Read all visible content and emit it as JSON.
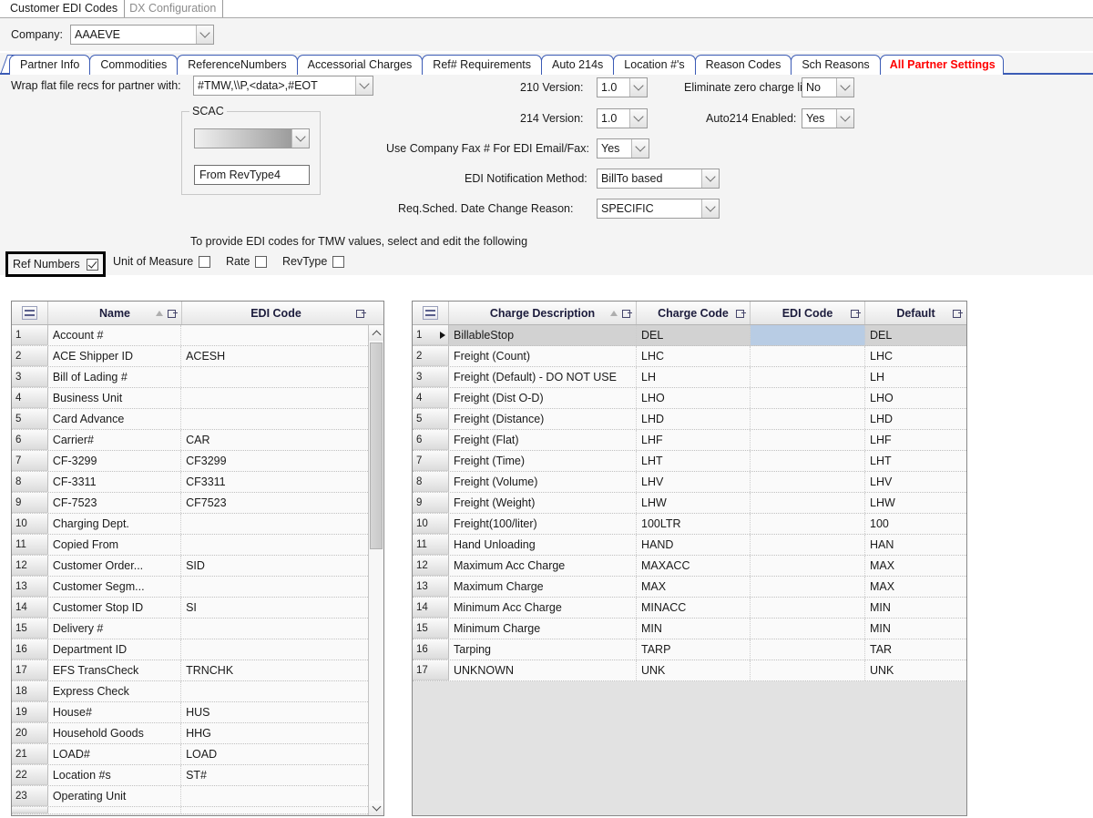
{
  "window_tabs": [
    {
      "label": "Customer EDI Codes",
      "active": true
    },
    {
      "label": "DX Configuration",
      "active": false
    }
  ],
  "company": {
    "label": "Company:",
    "value": "AAAEVE"
  },
  "tabs": [
    {
      "label": "Partner Info",
      "active": false
    },
    {
      "label": "Commodities",
      "active": false
    },
    {
      "label": "ReferenceNumbers",
      "active": false
    },
    {
      "label": "Accessorial Charges",
      "active": false
    },
    {
      "label": "Ref# Requirements",
      "active": false
    },
    {
      "label": "Auto 214s",
      "active": false
    },
    {
      "label": "Location #'s",
      "active": false
    },
    {
      "label": "Reason Codes",
      "active": false
    },
    {
      "label": "Sch Reasons",
      "active": false
    },
    {
      "label": "All Partner Settings",
      "active": true
    }
  ],
  "form": {
    "wrap_label": "Wrap flat file recs for partner with:",
    "wrap_value": "#TMW,\\\\P,<data>,#EOT",
    "scac_group_title": "SCAC",
    "scac_combo_value": "",
    "scac_text_value": "From RevType4",
    "v210_label": "210 Version:",
    "v210_value": "1.0",
    "v214_label": "214 Version:",
    "v214_value": "1.0",
    "fax_label": "Use Company Fax # For EDI Email/Fax:",
    "fax_value": "Yes",
    "notif_label": "EDI Notification Method:",
    "notif_value": "BillTo based",
    "reqsched_label": "Req.Sched. Date Change Reason:",
    "reqsched_value": "SPECIFIC",
    "elim_label": "Eliminate zero charge lines:",
    "elim_value": "No",
    "auto214_label": "Auto214 Enabled:",
    "auto214_value": "Yes"
  },
  "selector": {
    "hint": "To provide EDI codes for TMW values, select and edit the following",
    "options": [
      {
        "label": "Ref Numbers",
        "checked": true,
        "focused": true
      },
      {
        "label": "Unit of Measure",
        "checked": false,
        "focused": false
      },
      {
        "label": "Rate",
        "checked": false,
        "focused": false
      },
      {
        "label": "RevType",
        "checked": false,
        "focused": false
      }
    ]
  },
  "left_grid": {
    "columns": [
      "Name",
      "EDI Code"
    ],
    "sorted_column": "Name",
    "rows": [
      {
        "n": "1",
        "name": "Account #",
        "code": ""
      },
      {
        "n": "2",
        "name": "ACE Shipper ID",
        "code": "ACESH"
      },
      {
        "n": "3",
        "name": "Bill of Lading #",
        "code": ""
      },
      {
        "n": "4",
        "name": "Business Unit",
        "code": ""
      },
      {
        "n": "5",
        "name": "Card Advance",
        "code": ""
      },
      {
        "n": "6",
        "name": "Carrier#",
        "code": "CAR"
      },
      {
        "n": "7",
        "name": "CF-3299",
        "code": "CF3299"
      },
      {
        "n": "8",
        "name": "CF-3311",
        "code": "CF3311"
      },
      {
        "n": "9",
        "name": "CF-7523",
        "code": "CF7523"
      },
      {
        "n": "10",
        "name": "Charging Dept.",
        "code": ""
      },
      {
        "n": "11",
        "name": "Copied From",
        "code": ""
      },
      {
        "n": "12",
        "name": "Customer Order...",
        "code": "SID"
      },
      {
        "n": "13",
        "name": "Customer Segm...",
        "code": ""
      },
      {
        "n": "14",
        "name": "Customer Stop ID",
        "code": "SI"
      },
      {
        "n": "15",
        "name": "Delivery #",
        "code": ""
      },
      {
        "n": "16",
        "name": "Department ID",
        "code": ""
      },
      {
        "n": "17",
        "name": "EFS TransCheck",
        "code": "TRNCHK"
      },
      {
        "n": "18",
        "name": "Express Check",
        "code": ""
      },
      {
        "n": "19",
        "name": "House#",
        "code": "HUS"
      },
      {
        "n": "20",
        "name": "Household Goods",
        "code": "HHG"
      },
      {
        "n": "21",
        "name": "LOAD#",
        "code": "LOAD"
      },
      {
        "n": "22",
        "name": "Location #s",
        "code": "ST#"
      },
      {
        "n": "23",
        "name": "Operating Unit",
        "code": ""
      }
    ]
  },
  "right_grid": {
    "columns": [
      "Charge Description",
      "Charge Code",
      "EDI Code",
      "Default"
    ],
    "sorted_column": "Charge Description",
    "rows": [
      {
        "n": "1",
        "desc": "BillableStop",
        "charge": "DEL",
        "edi": "",
        "default": "DEL",
        "selected": true
      },
      {
        "n": "2",
        "desc": "Freight (Count)",
        "charge": "LHC",
        "edi": "",
        "default": "LHC",
        "selected": false
      },
      {
        "n": "3",
        "desc": "Freight (Default) - DO NOT USE",
        "charge": "LH",
        "edi": "",
        "default": "LH",
        "selected": false
      },
      {
        "n": "4",
        "desc": "Freight (Dist O-D)",
        "charge": "LHO",
        "edi": "",
        "default": "LHO",
        "selected": false
      },
      {
        "n": "5",
        "desc": "Freight (Distance)",
        "charge": "LHD",
        "edi": "",
        "default": "LHD",
        "selected": false
      },
      {
        "n": "6",
        "desc": "Freight (Flat)",
        "charge": "LHF",
        "edi": "",
        "default": "LHF",
        "selected": false
      },
      {
        "n": "7",
        "desc": "Freight (Time)",
        "charge": "LHT",
        "edi": "",
        "default": "LHT",
        "selected": false
      },
      {
        "n": "8",
        "desc": "Freight (Volume)",
        "charge": "LHV",
        "edi": "",
        "default": "LHV",
        "selected": false
      },
      {
        "n": "9",
        "desc": "Freight (Weight)",
        "charge": "LHW",
        "edi": "",
        "default": "LHW",
        "selected": false
      },
      {
        "n": "10",
        "desc": "Freight(100/liter)",
        "charge": "100LTR",
        "edi": "",
        "default": "100",
        "selected": false
      },
      {
        "n": "11",
        "desc": "Hand Unloading",
        "charge": "HAND",
        "edi": "",
        "default": "HAN",
        "selected": false
      },
      {
        "n": "12",
        "desc": "Maximum Acc Charge",
        "charge": "MAXACC",
        "edi": "",
        "default": "MAX",
        "selected": false
      },
      {
        "n": "13",
        "desc": "Maximum Charge",
        "charge": "MAX",
        "edi": "",
        "default": "MAX",
        "selected": false
      },
      {
        "n": "14",
        "desc": "Minimum Acc Charge",
        "charge": "MINACC",
        "edi": "",
        "default": "MIN",
        "selected": false
      },
      {
        "n": "15",
        "desc": "Minimum Charge",
        "charge": "MIN",
        "edi": "",
        "default": "MIN",
        "selected": false
      },
      {
        "n": "16",
        "desc": "Tarping",
        "charge": "TARP",
        "edi": "",
        "default": "TAR",
        "selected": false
      },
      {
        "n": "17",
        "desc": "UNKNOWN",
        "charge": "UNK",
        "edi": "",
        "default": "UNK",
        "selected": false
      }
    ]
  },
  "colors": {
    "tab_border": "#3b5bb5",
    "active_tab_text": "#ff0000",
    "editing_cell": "#b8cce4",
    "selected_row": "#d2d2d2",
    "panel_bg": "#f4f4f4"
  }
}
